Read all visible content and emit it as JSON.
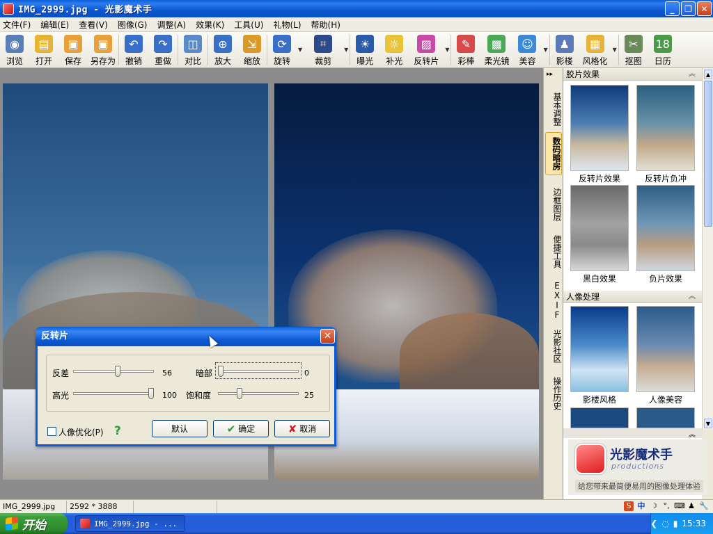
{
  "window": {
    "title": "IMG_2999.jpg - 光影魔术手",
    "minimize": "_",
    "maximize": "❐",
    "close": "✕"
  },
  "menu": [
    "文件(F)",
    "编辑(E)",
    "查看(V)",
    "图像(G)",
    "调整(A)",
    "效果(K)",
    "工具(U)",
    "礼物(L)",
    "帮助(H)"
  ],
  "toolbar": [
    {
      "label": "浏览",
      "icon": "eye-icon",
      "color": "#5a7fb8",
      "glyph": "◉"
    },
    {
      "label": "打开",
      "icon": "folder-icon",
      "color": "#e8b437",
      "glyph": "▤"
    },
    {
      "label": "保存",
      "icon": "save-icon",
      "color": "#e8a13a",
      "glyph": "▣"
    },
    {
      "label": "另存为",
      "icon": "save-as-icon",
      "color": "#e8a13a",
      "glyph": "▣"
    },
    {
      "label": "撤销",
      "icon": "undo-icon",
      "color": "#3a6fc8",
      "glyph": "↶"
    },
    {
      "label": "重做",
      "icon": "redo-icon",
      "color": "#3a6fc8",
      "glyph": "↷"
    },
    {
      "label": "对比",
      "icon": "compare-icon",
      "color": "#5a8bc8",
      "glyph": "◫"
    },
    {
      "label": "放大",
      "icon": "zoom-in-icon",
      "color": "#3a6fc8",
      "glyph": "⊕"
    },
    {
      "label": "缩放",
      "icon": "resize-icon",
      "color": "#d99a2a",
      "glyph": "⇲"
    },
    {
      "label": "旋转",
      "icon": "rotate-icon",
      "color": "#3a6fc8",
      "glyph": "⟳"
    },
    {
      "label": "裁剪",
      "icon": "crop-icon",
      "color": "#2a4a8a",
      "glyph": "⌗"
    },
    {
      "label": "曝光",
      "icon": "exposure-icon",
      "color": "#2a5aa8",
      "glyph": "☀"
    },
    {
      "label": "补光",
      "icon": "fill-light-icon",
      "color": "#e8c43a",
      "glyph": "☼"
    },
    {
      "label": "反转片",
      "icon": "reversal-film-icon",
      "color": "#c84aa8",
      "glyph": "▨"
    },
    {
      "label": "彩棒",
      "icon": "color-wand-icon",
      "color": "#d84a4a",
      "glyph": "✎"
    },
    {
      "label": "柔光镜",
      "icon": "soft-light-icon",
      "color": "#4aa858",
      "glyph": "▩"
    },
    {
      "label": "美容",
      "icon": "beauty-icon",
      "color": "#3a8ad8",
      "glyph": "☺"
    },
    {
      "label": "影楼",
      "icon": "studio-icon",
      "color": "#5a7ab8",
      "glyph": "♟"
    },
    {
      "label": "风格化",
      "icon": "stylize-icon",
      "color": "#e8b437",
      "glyph": "▦"
    },
    {
      "label": "抠图",
      "icon": "cutout-icon",
      "color": "#6a8a5a",
      "glyph": "✂"
    },
    {
      "label": "日历",
      "icon": "calendar-icon",
      "color": "#4a9a4a",
      "glyph": "18"
    }
  ],
  "right_tabs": [
    "基本调整",
    "数码暗房",
    "边框图层",
    "便捷工具",
    "EXIF",
    "光影社区",
    "操作历史"
  ],
  "panel": {
    "section1": "胶片效果",
    "section2": "人像处理",
    "thumbs1": [
      "反转片效果",
      "反转片负冲",
      "黑白效果",
      "负片效果"
    ],
    "thumbs2": [
      "影楼风格",
      "人像美容"
    ]
  },
  "brand": {
    "name": "光影魔术手",
    "sub": "productions",
    "tagline": "给您带来最简便易用的图像处理体验"
  },
  "dialog": {
    "title": "反转片",
    "sliders": [
      {
        "label": "反差",
        "value": "56"
      },
      {
        "label": "暗部",
        "value": "0"
      },
      {
        "label": "高光",
        "value": "100"
      },
      {
        "label": "饱和度",
        "value": "25"
      }
    ],
    "levels": {
      "contrast": 0.56,
      "shadow": 0.0,
      "highlight": 1.0,
      "saturation": 0.25
    },
    "checkbox": "人像优化(P)",
    "help": "?",
    "btn_default": "默认",
    "btn_ok": "确定",
    "btn_cancel": "取消"
  },
  "status": {
    "file": "IMG_2999.jpg",
    "size": "2592 * 3888"
  },
  "ime": [
    "S",
    "中",
    "☽",
    "°,",
    "⌨",
    "♟",
    "🔧"
  ],
  "taskbar": {
    "start": "开始",
    "item": "IMG_2999.jpg - ...",
    "clock": "15:33"
  }
}
